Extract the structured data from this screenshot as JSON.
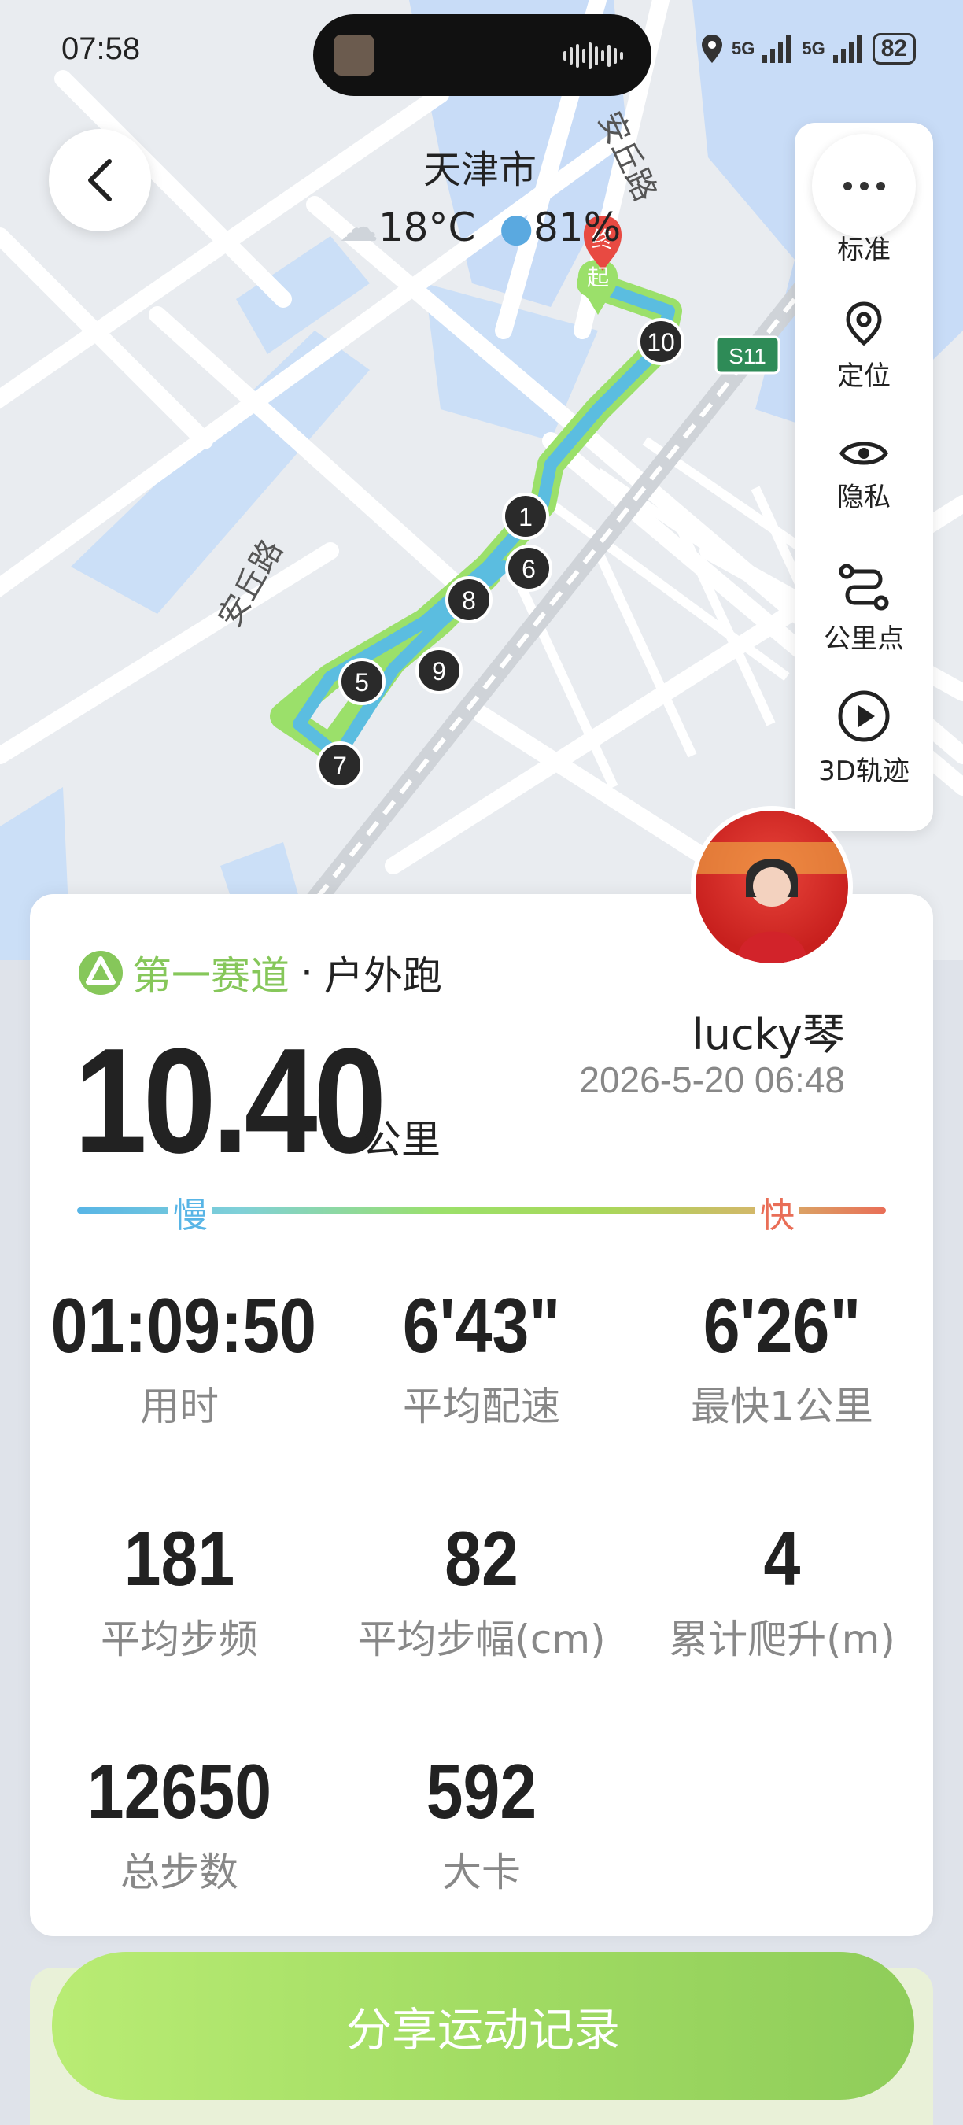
{
  "status_bar": {
    "time": "07:58",
    "network1": "5G",
    "network2": "5G",
    "battery": "82"
  },
  "map": {
    "city": "天津市",
    "weather": "18°C",
    "humidity": "81%",
    "road_label": "安丘路",
    "highway": "S11",
    "start_label": "起",
    "end_label": "终",
    "km_markers": [
      "1",
      "5",
      "6",
      "7",
      "8",
      "9",
      "10"
    ]
  },
  "sidebar": {
    "items": [
      {
        "label": "标准",
        "icon": "more-icon"
      },
      {
        "label": "定位",
        "icon": "location-icon"
      },
      {
        "label": "隐私",
        "icon": "eye-icon"
      },
      {
        "label": "公里点",
        "icon": "route-icon"
      },
      {
        "label": "3D轨迹",
        "icon": "play-icon"
      }
    ]
  },
  "record": {
    "brand": "第一赛道",
    "separator": "·",
    "sport_type": "户外跑",
    "distance": "10.40",
    "distance_unit": "公里",
    "username": "lucky琴",
    "datetime": "2026-5-20 06:48",
    "pace_slow": "慢",
    "pace_fast": "快",
    "metrics": [
      {
        "value": "01:09:50",
        "label": "用时"
      },
      {
        "value": "6'43\"",
        "label": "平均配速"
      },
      {
        "value": "6'26\"",
        "label": "最快1公里"
      },
      {
        "value": "181",
        "label": "平均步频"
      },
      {
        "value": "82",
        "label": "平均步幅(cm)"
      },
      {
        "value": "4",
        "label": "累计爬升(m)"
      },
      {
        "value": "12650",
        "label": "总步数"
      },
      {
        "value": "592",
        "label": "大卡"
      }
    ]
  },
  "share_button": "分享运动记录",
  "colors": {
    "accent_green": "#86c75a",
    "slow_blue": "#58b5e6",
    "fast_red": "#e96e57",
    "track_blue": "#5bbde0",
    "track_green": "#9be06a"
  }
}
